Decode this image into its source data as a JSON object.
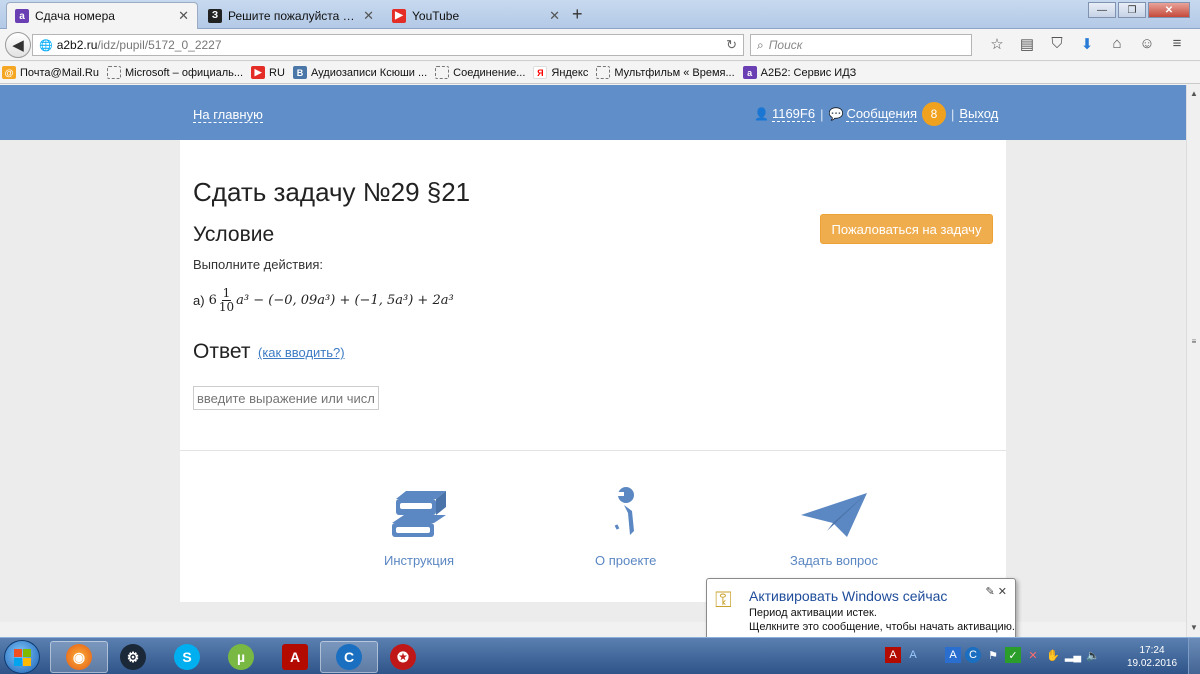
{
  "browser": {
    "tabs": [
      {
        "title": "Сдача номера",
        "icon": "a2b2-icon",
        "color": "#6a3fb3"
      },
      {
        "title": "Решите пожалуйста очен...",
        "icon": "znanija-icon",
        "color": "#222222"
      },
      {
        "title": "YouTube",
        "icon": "youtube-icon",
        "color": "#e52d27"
      }
    ],
    "url_host": "a2b2.ru",
    "url_path": "/idz/pupil/5172_0_2227",
    "search_placeholder": "Поиск",
    "bookmarks": [
      {
        "label": "Почта@Mail.Ru",
        "icon": "mailru-icon",
        "color": "#f5a623"
      },
      {
        "label": "Microsoft – официаль...",
        "icon": "page-icon",
        "color": ""
      },
      {
        "label": "RU",
        "icon": "youtube-icon",
        "color": "#e52d27"
      },
      {
        "label": "Аудиозаписи Ксюши ...",
        "icon": "vk-icon",
        "color": "#4a76a8"
      },
      {
        "label": "Соединение...",
        "icon": "page-icon",
        "color": ""
      },
      {
        "label": "Яндекс",
        "icon": "yandex-icon",
        "color": "#ff0000"
      },
      {
        "label": "Мультфильм « Время...",
        "icon": "page-icon",
        "color": ""
      },
      {
        "label": "А2Б2: Сервис ИДЗ",
        "icon": "a2b2-icon",
        "color": "#6a3fb3"
      }
    ]
  },
  "header": {
    "home": "На главную",
    "user": "1169F6",
    "messages": "Сообщения",
    "messages_count": "8",
    "logout": "Выход",
    "separator": "|"
  },
  "task": {
    "title": "Сдать задачу №29 §21",
    "condition_heading": "Условие",
    "condition_text": "Выполните действия:",
    "expr_label": "а)",
    "expr_whole": "6",
    "expr_num": "1",
    "expr_den": "10",
    "expr_rest": "a³ − (−0, 09a³) + (−1, 5a³) + 2a³",
    "complain_button": "Пожаловаться на задачу",
    "answer_heading": "Ответ",
    "howto_link": "(как вводить?)",
    "answer_placeholder": "введите выражение или числ"
  },
  "footer": {
    "instruction": "Инструкция",
    "about": "О проекте",
    "ask": "Задать вопрос"
  },
  "notification": {
    "title": "Активировать Windows сейчас",
    "line1": "Период активации истек.",
    "line2": "Щелкните это сообщение, чтобы начать активацию."
  },
  "taskbar": {
    "time": "17:24",
    "date": "19.02.2016",
    "apps": [
      "firefox-icon",
      "steam-icon",
      "skype-icon",
      "utorrent-icon",
      "acrobat-icon",
      "ccleaner-icon",
      "game-icon"
    ]
  },
  "colors": {
    "header_blue": "#5f8ec9",
    "accent_orange": "#f0ad4e",
    "link_blue": "#3e7bc4"
  }
}
